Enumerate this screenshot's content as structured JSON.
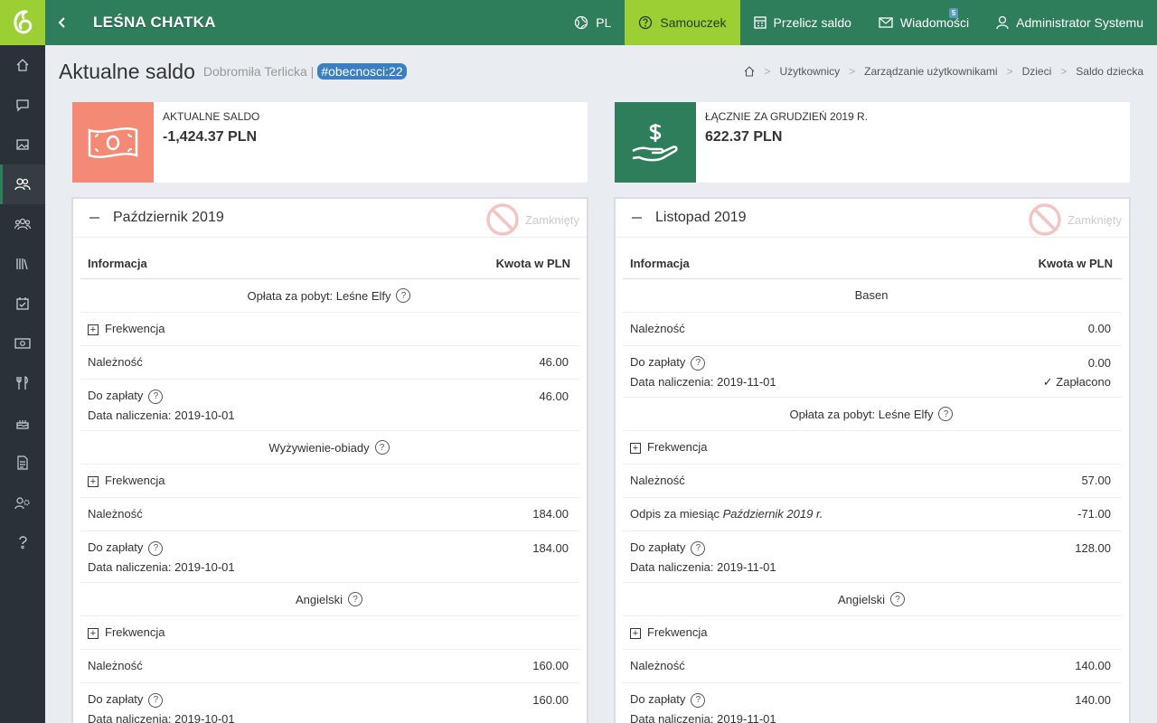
{
  "app": {
    "brand": "LEŚNA CHATKA"
  },
  "topnav": {
    "lang": "PL",
    "tutorial": "Samouczek",
    "recalc": "Przelicz saldo",
    "messages": "Wiadomości",
    "messages_badge": "5",
    "user": "Administrator Systemu"
  },
  "page": {
    "title": "Aktualne saldo",
    "subtitle": "Dobromiła Terlicka |",
    "tag": "#obecnosci:22"
  },
  "breadcrumb": [
    "Użytkownicy",
    "Zarządzanie użytkownikami",
    "Dzieci",
    "Saldo dziecka"
  ],
  "stats": {
    "balance_label": "AKTUALNE SALDO",
    "balance_value": "-1,424.37 PLN",
    "balance_color": "#f48a76",
    "total_label": "ŁĄCZNIE ZA GRUDZIEŃ 2019 R.",
    "total_value": "622.37 PLN",
    "total_color": "#2e7d5b"
  },
  "colors": {
    "accent": "#2e7d5b",
    "highlight": "#9ccf33",
    "tag": "#3a7fc2"
  },
  "table_headers": {
    "info": "Informacja",
    "amount": "Kwota w PLN"
  },
  "closed_label": "Zamknięty",
  "panels": [
    {
      "title": "Październik 2019",
      "rows": {
        "s1": "Opłata za pobyt: Leśne Elfy",
        "s1_freq": "Frekwencja",
        "s1_due_label": "Należność",
        "s1_due": "46.00",
        "s1_pay_label": "Do zapłaty",
        "s1_pay": "46.00",
        "s1_date": "Data naliczenia: 2019-10-01",
        "s2": "Wyżywienie-obiady",
        "s2_freq": "Frekwencja",
        "s2_due_label": "Należność",
        "s2_due": "184.00",
        "s2_pay_label": "Do zapłaty",
        "s2_pay": "184.00",
        "s2_date": "Data naliczenia: 2019-10-01",
        "s3": "Angielski",
        "s3_freq": "Frekwencja",
        "s3_due_label": "Należność",
        "s3_due": "160.00",
        "s3_pay_label": "Do zapłaty",
        "s3_pay": "160.00",
        "s3_date": "Data naliczenia: 2019-10-01"
      }
    },
    {
      "title": "Listopad 2019",
      "rows": {
        "s1": "Basen",
        "s1_due_label": "Należność",
        "s1_due": "0.00",
        "s1_pay_label": "Do zapłaty",
        "s1_pay": "0.00",
        "s1_date": "Data naliczenia: 2019-11-01",
        "s1_paid": "Zapłacono",
        "s2": "Opłata za pobyt: Leśne Elfy",
        "s2_freq": "Frekwencja",
        "s2_due_label": "Należność",
        "s2_due": "57.00",
        "s2_writeoff_label": "Odpis za miesiąc",
        "s2_writeoff_month": "Październik 2019 r.",
        "s2_writeoff": "-71.00",
        "s2_pay_label": "Do zapłaty",
        "s2_pay": "128.00",
        "s2_date": "Data naliczenia: 2019-11-01",
        "s3": "Angielski",
        "s3_freq": "Frekwencja",
        "s3_due_label": "Należność",
        "s3_due": "140.00",
        "s3_pay_label": "Do zapłaty",
        "s3_pay": "140.00",
        "s3_date": "Data naliczenia: 2019-11-01"
      }
    }
  ]
}
